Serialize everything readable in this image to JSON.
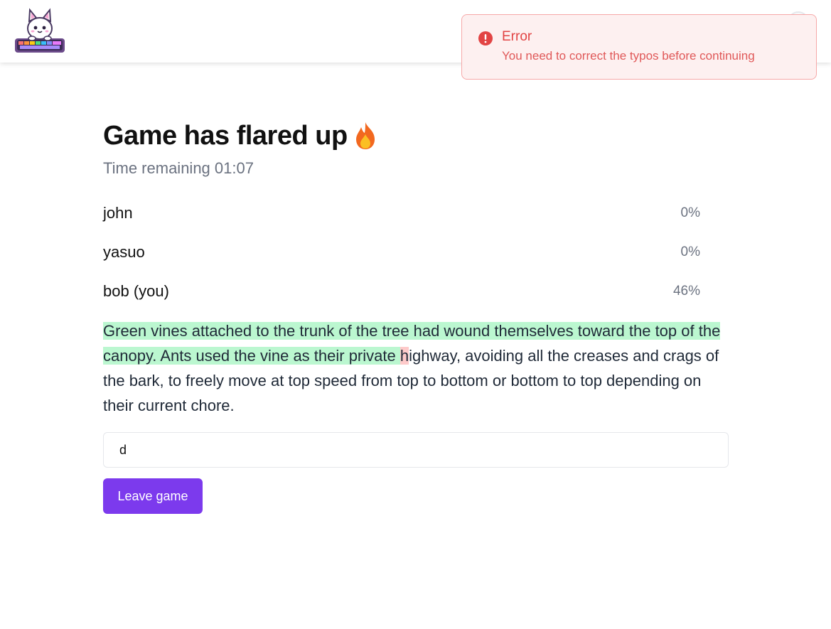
{
  "header": {
    "logo_icon": "cat-keyboard-logo-icon"
  },
  "toast": {
    "icon": "exclamation-circle-icon",
    "title": "Error",
    "message": "You need to correct the typos before continuing",
    "color": "#e24444"
  },
  "game": {
    "title": "Game has flared up",
    "title_icon": "fire-icon",
    "timer_label": "Time remaining",
    "timer_value": "01:07"
  },
  "players": [
    {
      "name": "john",
      "progress": "0%"
    },
    {
      "name": "yasuo",
      "progress": "0%"
    },
    {
      "name": "bob (you)",
      "progress": "46%"
    }
  ],
  "passage": {
    "typed": "Green vines attached to the trunk of the tree had wound themselves toward the top of the canopy. Ants used the vine as their private ",
    "error_char": "h",
    "remaining": "ighway, avoiding all the creases and crags of the bark, to freely move at top speed from top to bottom or bottom to top depending on their current chore."
  },
  "input": {
    "value": "d"
  },
  "actions": {
    "leave_label": "Leave game"
  },
  "colors": {
    "accent": "#7c3aed",
    "typed_bg": "#bbf7d0",
    "error_bg": "#fecaca"
  }
}
